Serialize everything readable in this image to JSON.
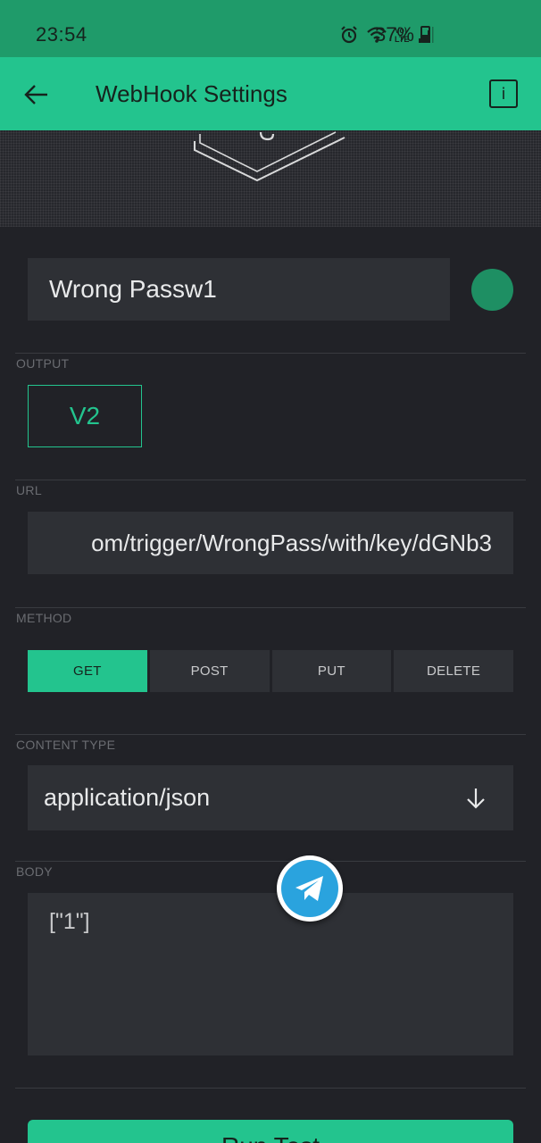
{
  "status_bar": {
    "time": "23:54",
    "battery": "37%",
    "icons": [
      "alarm-icon",
      "wifi-icon",
      "volte-icon",
      "signal-icon",
      "battery-icon"
    ],
    "volte_text": "Vo) LTE"
  },
  "app_bar": {
    "title": "WebHook Settings",
    "back_icon": "arrow-left-icon",
    "info_label": "i"
  },
  "widget": {
    "name": "Wrong Passw1",
    "color": "#1e8f63"
  },
  "output": {
    "label": "OUTPUT",
    "pin": "V2"
  },
  "url": {
    "label": "URL",
    "value": "om/trigger/WrongPass/with/key/dGNb3"
  },
  "method": {
    "label": "METHOD",
    "options": [
      "GET",
      "POST",
      "PUT",
      "DELETE"
    ],
    "selected": "GET"
  },
  "content_type": {
    "label": "CONTENT TYPE",
    "value": "application/json"
  },
  "body": {
    "label": "BODY",
    "value": "[\"1\"]"
  },
  "test_button": {
    "label": "Run Test"
  },
  "colors": {
    "accent": "#23c48e",
    "background": "#212227",
    "field": "#2e3035",
    "telegram": "#2aa3de"
  }
}
